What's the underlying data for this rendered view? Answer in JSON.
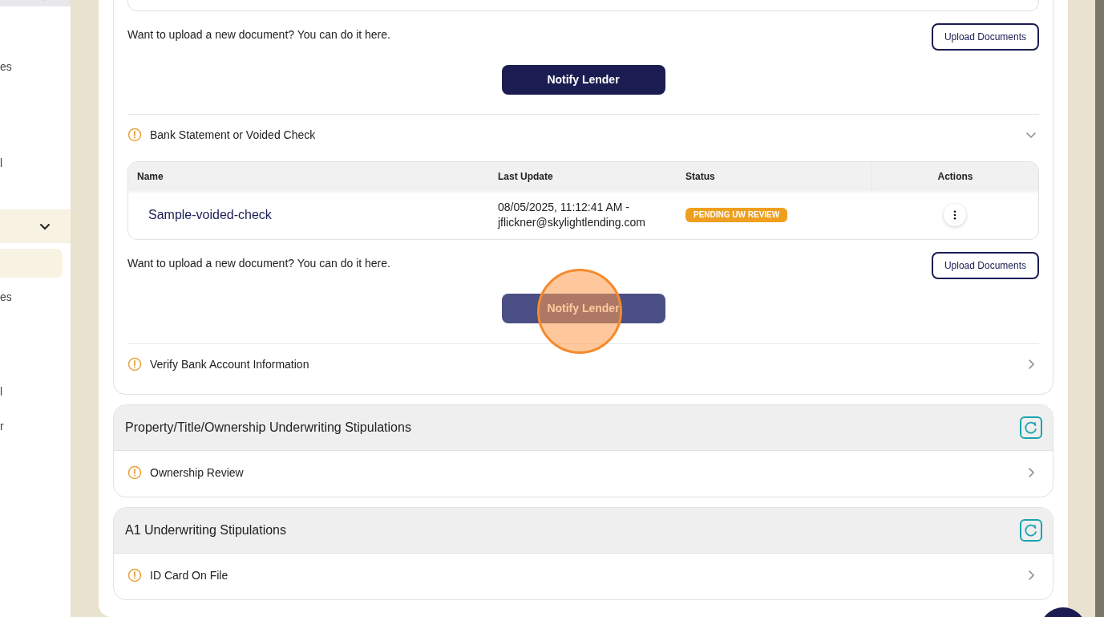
{
  "sidebar": {
    "groups": [
      {
        "expanded": true,
        "items": [
          {
            "label": "es",
            "selected": false
          },
          {
            "label": "l",
            "selected": false
          }
        ]
      },
      {
        "expanded": true,
        "items": [
          {
            "selected": true
          },
          {
            "label": "es",
            "selected": false
          },
          {
            "label": "l",
            "selected": false
          },
          {
            "label": "r",
            "selected": false
          }
        ]
      }
    ]
  },
  "main_card": {
    "top_section": {
      "upload_prompt": "Want to upload a new document? You can do it here.",
      "upload_button": "Upload Documents",
      "notify_button": {
        "label": "Notify Lender",
        "hovered": false
      }
    },
    "stipulations": [
      {
        "title": "Bank Statement or Voided Check",
        "expanded": true,
        "table": {
          "columns": [
            "Name",
            "Last Update",
            "Status",
            "Actions"
          ],
          "rows": [
            {
              "name": "Sample-voided-check",
              "last_update": "08/05/2025, 11:12:41 AM - jflickner@skylightlending.com",
              "status": "PENDING UW REVIEW"
            }
          ]
        },
        "upload_prompt": "Want to upload a new document? You can do it here.",
        "upload_button": "Upload Documents",
        "notify_button": {
          "label": "Notify Lender",
          "hovered": true
        }
      },
      {
        "title": "Verify Bank Account Information",
        "expanded": false
      }
    ]
  },
  "groups": [
    {
      "title": "Property/Title/Ownership Underwriting Stipulations",
      "items": [
        {
          "title": "Ownership Review",
          "expanded": false
        }
      ]
    },
    {
      "title": "A1 Underwriting Stipulations",
      "items": [
        {
          "title": "ID Card On File",
          "expanded": false
        }
      ]
    }
  ]
}
